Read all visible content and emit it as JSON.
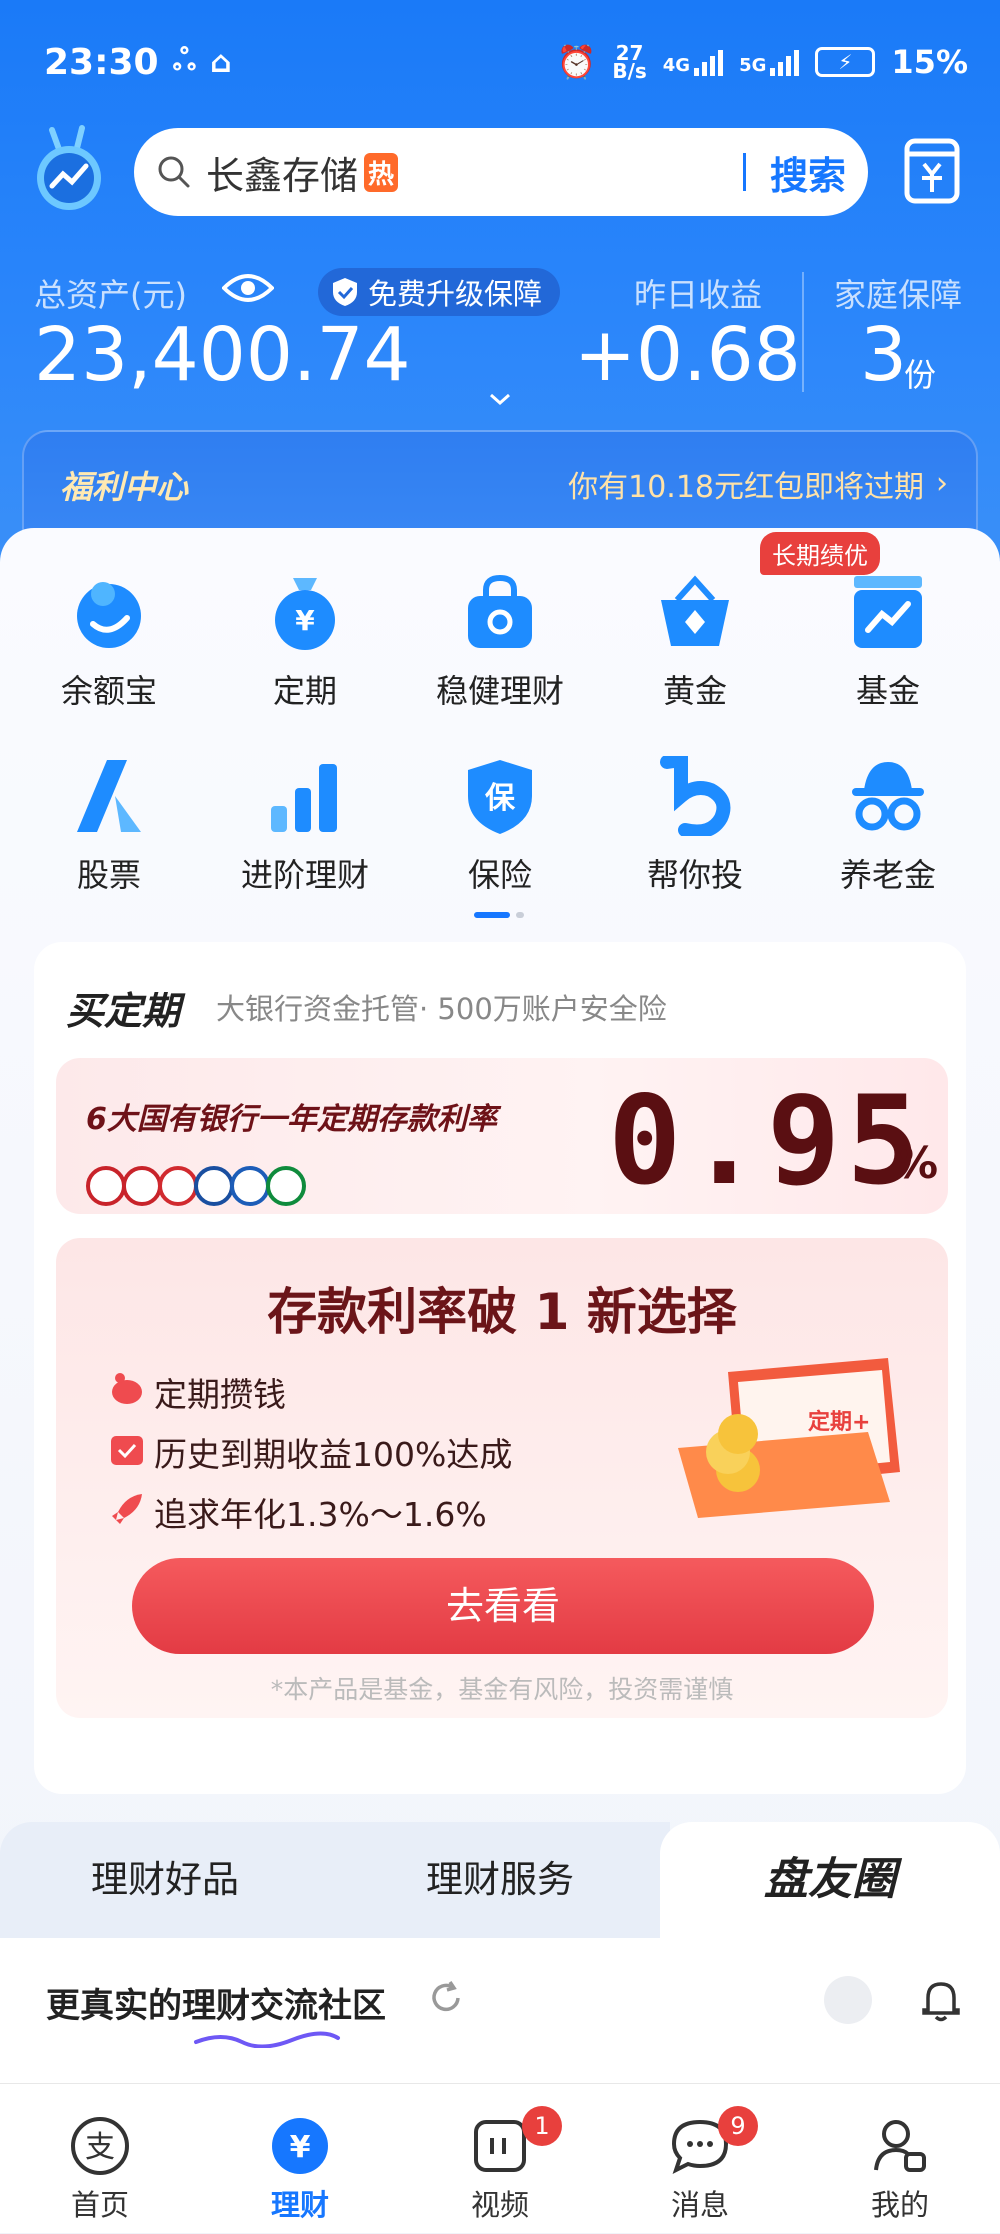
{
  "status_bar": {
    "time": "23:30",
    "speed_top": "27",
    "speed_unit": "B/s",
    "net1": "4G",
    "net2": "5G",
    "battery": "15%"
  },
  "header": {
    "search_placeholder": "长鑫存储",
    "hot_badge": "热",
    "search_button": "搜索"
  },
  "assets": {
    "total_label": "总资产(元)",
    "total_value": "23,400.74",
    "protect_label": "免费升级保障",
    "yesterday_label": "昨日收益",
    "yesterday_value": "+0.68",
    "family_label": "家庭保障",
    "family_value": "3",
    "family_unit": "份"
  },
  "welfare": {
    "title": "福利中心",
    "message": "你有10.18元红包即将过期"
  },
  "grid": {
    "badge": "长期绩优",
    "items": [
      {
        "label": "余额宝",
        "icon": "yuebao-icon"
      },
      {
        "label": "定期",
        "icon": "money-bag-icon"
      },
      {
        "label": "稳健理财",
        "icon": "lock-bag-icon"
      },
      {
        "label": "黄金",
        "icon": "gold-basket-icon"
      },
      {
        "label": "基金",
        "icon": "fund-chart-icon"
      },
      {
        "label": "股票",
        "icon": "stock-a-icon"
      },
      {
        "label": "进阶理财",
        "icon": "bar-chart-icon"
      },
      {
        "label": "保险",
        "icon": "insurance-shield-icon"
      },
      {
        "label": "帮你投",
        "icon": "help-invest-icon"
      },
      {
        "label": "养老金",
        "icon": "pension-hat-icon"
      }
    ]
  },
  "card": {
    "title": "买定期",
    "subtitle": "大银行资金托管· 500万账户安全险",
    "rate_text": "6大国有银行一年定期存款利率",
    "rate_value": "0.95",
    "rate_unit": "%",
    "promo_title": "存款利率破 1 新选择",
    "features": [
      "定期攒钱",
      "历史到期收益100%达成",
      "追求年化1.3%～1.6%"
    ],
    "button": "去看看",
    "disclaimer": "*本产品是基金，基金有风险，投资需谨慎",
    "wallet_label": "定期+"
  },
  "tabs": [
    "理财好品",
    "理财服务",
    "盘友圈"
  ],
  "feed": {
    "title": "更真实的理财交流社区"
  },
  "nav": {
    "items": [
      {
        "label": "首页"
      },
      {
        "label": "理财"
      },
      {
        "label": "视频",
        "badge": "1"
      },
      {
        "label": "消息",
        "badge": "9"
      },
      {
        "label": "我的"
      }
    ]
  },
  "colors": {
    "primary": "#1677ff",
    "hero": "#1a7af8",
    "accent_red": "#e8403d",
    "rate_text": "#5a0f12"
  }
}
